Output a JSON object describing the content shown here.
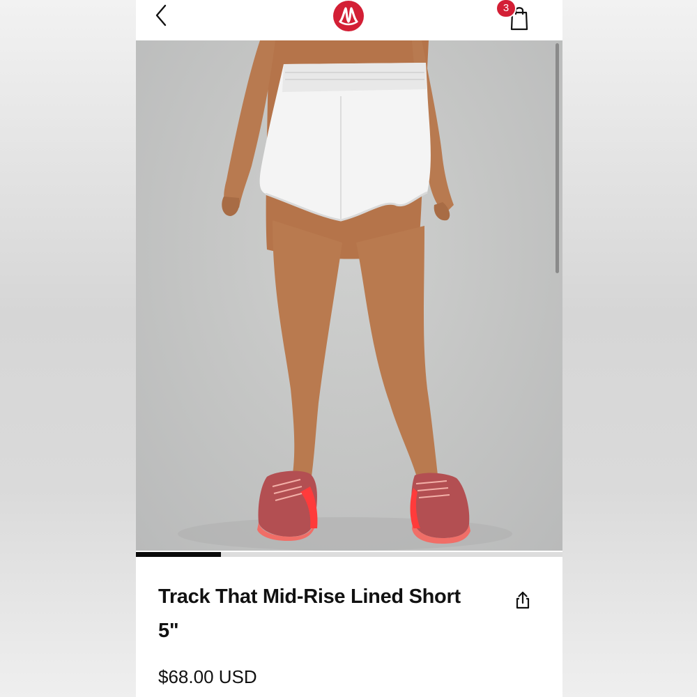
{
  "header": {
    "back_icon": "chevron-left-icon",
    "logo_icon": "lululemon-logo",
    "bag_icon": "shopping-bag-icon",
    "bag_count": "3",
    "brand_color": "#d31f35"
  },
  "gallery": {
    "image_description": "model wearing white shorts and red running shoes",
    "progress": 0.2
  },
  "product": {
    "title": "Track That Mid-Rise Lined Short 5\"",
    "price": "$68.00 USD",
    "share_icon": "share-icon"
  }
}
